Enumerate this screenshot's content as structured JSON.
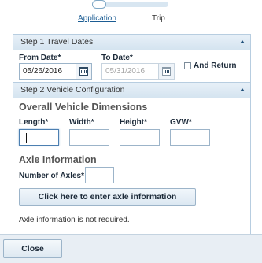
{
  "progress": {
    "steps": [
      {
        "label": "Application",
        "active": true
      },
      {
        "label": "Trip",
        "active": false
      }
    ]
  },
  "step1": {
    "title": "Step 1 Travel Dates",
    "from_label": "From Date*",
    "from_value": "05/26/2016",
    "to_label": "To Date*",
    "to_value": "05/31/2016",
    "return_label": "And Return",
    "return_checked": false
  },
  "step2": {
    "title": "Step 2 Vehicle Configuration",
    "dimensions_heading": "Overall Vehicle Dimensions",
    "length_label": "Length*",
    "width_label": "Width*",
    "height_label": "Height*",
    "gvw_label": "GVW*",
    "length_value": "",
    "width_value": "",
    "height_value": "",
    "gvw_value": "",
    "axle_heading": "Axle Information",
    "axles_label": "Number of Axles*",
    "axles_value": "",
    "axle_button_label": "Click here to enter axle information",
    "axle_note": "Axle information is not required."
  },
  "footer": {
    "close_label": "Close"
  },
  "colors": {
    "link": "#1b5c93",
    "header_bg": "#dde9f4",
    "border": "#b7cde0"
  }
}
